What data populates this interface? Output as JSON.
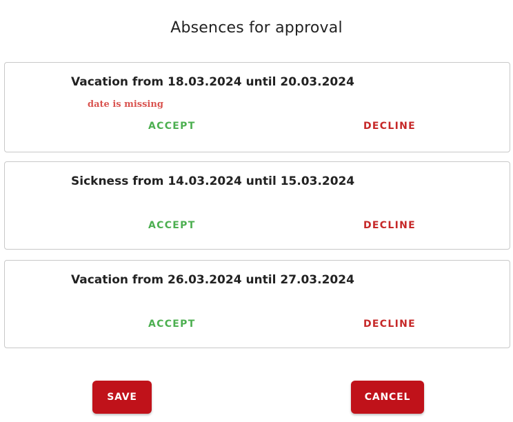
{
  "dialog": {
    "title": "Absences for approval"
  },
  "absences": [
    {
      "title": "Vacation from 18.03.2024 until 20.03.2024",
      "error": "date is missing",
      "accept_label": "ACCEPT",
      "decline_label": "DECLINE"
    },
    {
      "title": "Sickness from 14.03.2024 until 15.03.2024",
      "accept_label": "ACCEPT",
      "decline_label": "DECLINE"
    },
    {
      "title": "Vacation from 26.03.2024 until 27.03.2024",
      "accept_label": "ACCEPT",
      "decline_label": "DECLINE"
    }
  ],
  "footer": {
    "save_label": "SAVE",
    "cancel_label": "CANCEL"
  },
  "colors": {
    "accept": "#4caf50",
    "decline": "#c62828",
    "error": "#d9534f",
    "primary_button": "#c0121a"
  }
}
